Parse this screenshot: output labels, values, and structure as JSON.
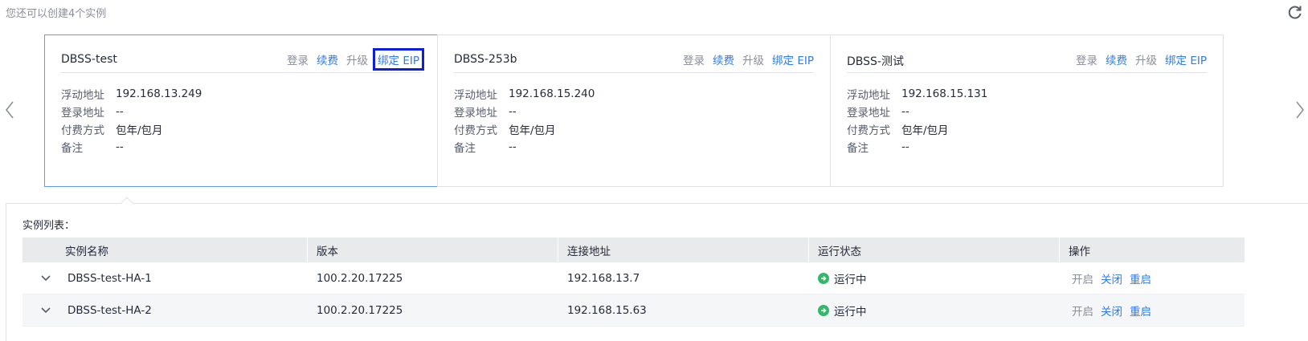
{
  "quota_text": "您还可以创建4个实例",
  "colors": {
    "accent": "#2f7be8",
    "success": "#33b76a",
    "highlight_box": "#0a1fe0"
  },
  "cards": [
    {
      "name": "DBSS-test",
      "ops": [
        "登录",
        "续费",
        "升级",
        "绑定 EIP"
      ],
      "fields": [
        {
          "label": "浮动地址",
          "value": "192.168.13.249"
        },
        {
          "label": "登录地址",
          "value": "--"
        },
        {
          "label": "付费方式",
          "value": "包年/包月"
        },
        {
          "label": "备注",
          "value": "--"
        }
      ]
    },
    {
      "name": "DBSS-253b",
      "ops": [
        "登录",
        "续费",
        "升级",
        "绑定 EIP"
      ],
      "fields": [
        {
          "label": "浮动地址",
          "value": "192.168.15.240"
        },
        {
          "label": "登录地址",
          "value": "--"
        },
        {
          "label": "付费方式",
          "value": "包年/包月"
        },
        {
          "label": "备注",
          "value": "--"
        }
      ]
    },
    {
      "name": "DBSS-测试",
      "ops": [
        "登录",
        "续费",
        "升级",
        "绑定 EIP"
      ],
      "fields": [
        {
          "label": "浮动地址",
          "value": "192.168.15.131"
        },
        {
          "label": "登录地址",
          "value": "--"
        },
        {
          "label": "付费方式",
          "value": "包年/包月"
        },
        {
          "label": "备注",
          "value": "--"
        }
      ]
    }
  ],
  "list": {
    "caption": "实例列表：",
    "columns": [
      "实例名称",
      "版本",
      "连接地址",
      "运行状态",
      "操作"
    ],
    "rows": [
      {
        "name": "DBSS-test-HA-1",
        "version": "100.2.20.17225",
        "address": "192.168.13.7",
        "status": "运行中",
        "ops": [
          "开启",
          "关闭",
          "重启"
        ]
      },
      {
        "name": "DBSS-test-HA-2",
        "version": "100.2.20.17225",
        "address": "192.168.15.63",
        "status": "运行中",
        "ops": [
          "开启",
          "关闭",
          "重启"
        ]
      }
    ]
  }
}
